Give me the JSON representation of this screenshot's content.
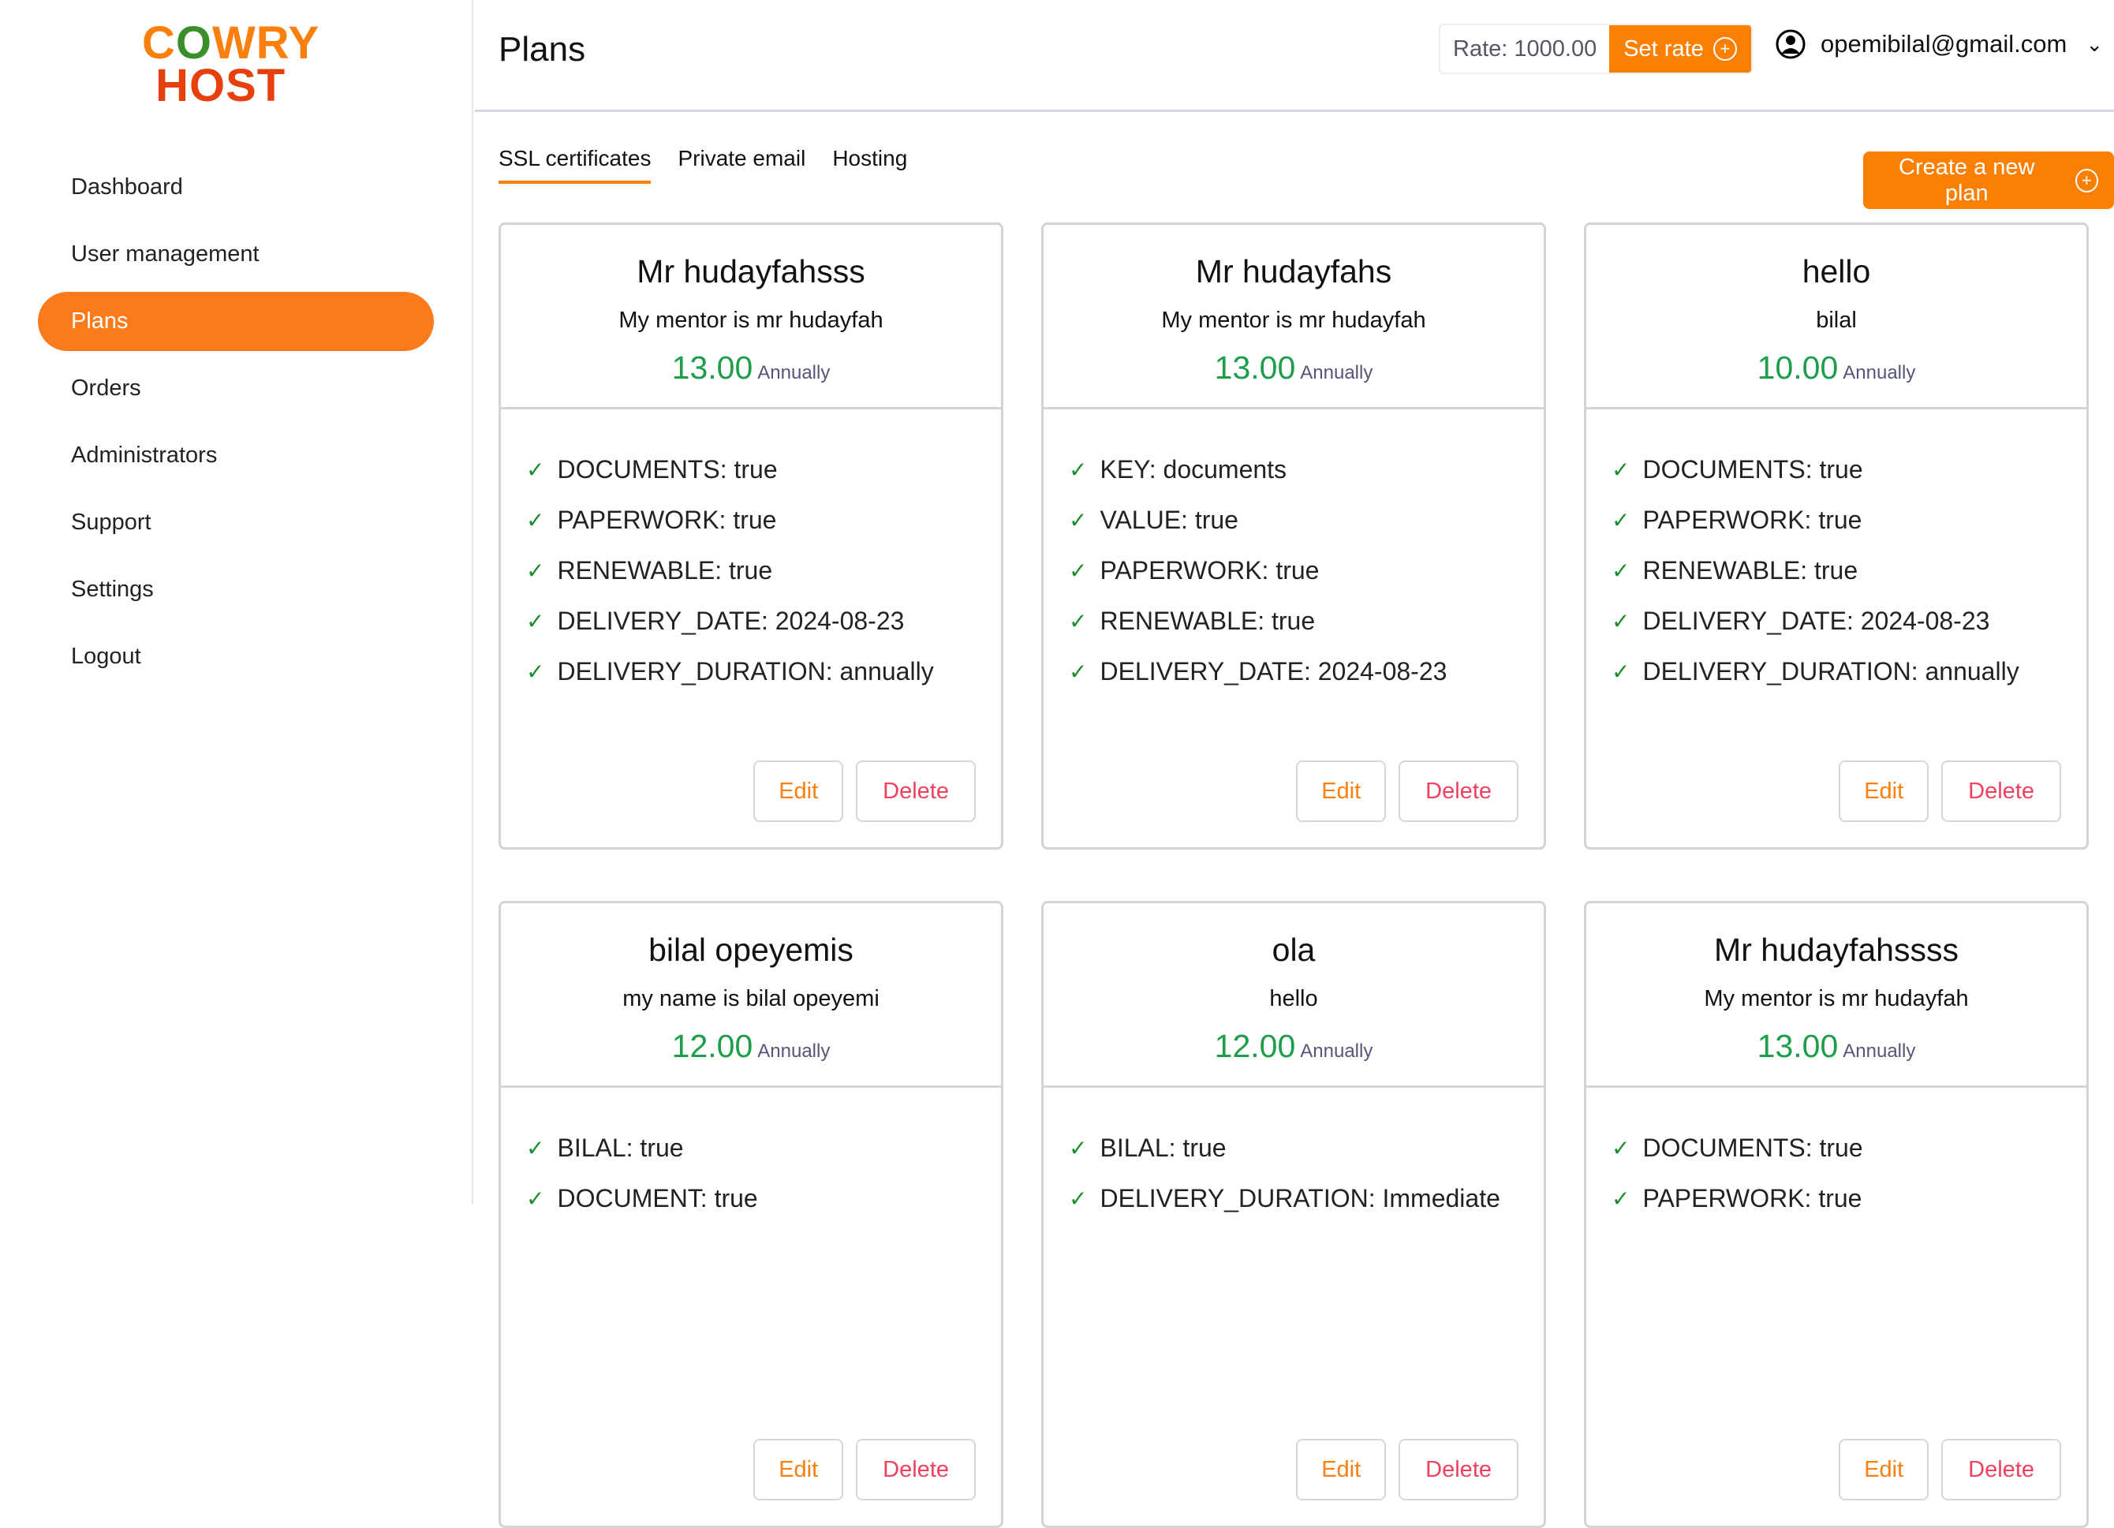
{
  "brand": {
    "line1": "COWRY",
    "line2": "HOST"
  },
  "sidebar": {
    "items": [
      {
        "label": "Dashboard"
      },
      {
        "label": "User management"
      },
      {
        "label": "Plans",
        "active": true
      },
      {
        "label": "Orders"
      },
      {
        "label": "Administrators"
      },
      {
        "label": "Support"
      },
      {
        "label": "Settings"
      },
      {
        "label": "Logout"
      }
    ]
  },
  "header": {
    "title": "Plans",
    "rate": "Rate: 1000.00",
    "set_rate": "Set rate",
    "user_email": "opemibilal@gmail.com"
  },
  "tabs": [
    {
      "label": "SSL certificates",
      "active": true
    },
    {
      "label": "Private email"
    },
    {
      "label": "Hosting"
    }
  ],
  "create_label": "Create a new plan",
  "edit_label": "Edit",
  "delete_label": "Delete",
  "plans": [
    {
      "title": "Mr hudayfahsss",
      "subtitle": "My mentor is mr hudayfah",
      "price": "13.00",
      "period": "Annually",
      "features": [
        "DOCUMENTS: true",
        "PAPERWORK: true",
        "RENEWABLE: true",
        "DELIVERY_DATE: 2024-08-23",
        "DELIVERY_DURATION: annually"
      ]
    },
    {
      "title": "Mr hudayfahs",
      "subtitle": "My mentor is mr hudayfah",
      "price": "13.00",
      "period": "Annually",
      "features": [
        "KEY: documents",
        "VALUE: true",
        "PAPERWORK: true",
        "RENEWABLE: true",
        "DELIVERY_DATE: 2024-08-23"
      ]
    },
    {
      "title": "hello",
      "subtitle": "bilal",
      "price": "10.00",
      "period": "Annually",
      "features": [
        "DOCUMENTS: true",
        "PAPERWORK: true",
        "RENEWABLE: true",
        "DELIVERY_DATE: 2024-08-23",
        "DELIVERY_DURATION: annually"
      ]
    },
    {
      "title": "bilal opeyemis",
      "subtitle": "my name is bilal opeyemi",
      "price": "12.00",
      "period": "Annually",
      "features": [
        "BILAL: true",
        "DOCUMENT: true"
      ]
    },
    {
      "title": "ola",
      "subtitle": "hello",
      "price": "12.00",
      "period": "Annually",
      "features": [
        "BILAL: true",
        "DELIVERY_DURATION: Immediate"
      ]
    },
    {
      "title": "Mr hudayfahssss",
      "subtitle": "My mentor is mr hudayfah",
      "price": "13.00",
      "period": "Annually",
      "features": [
        "DOCUMENTS: true",
        "PAPERWORK: true"
      ]
    }
  ]
}
